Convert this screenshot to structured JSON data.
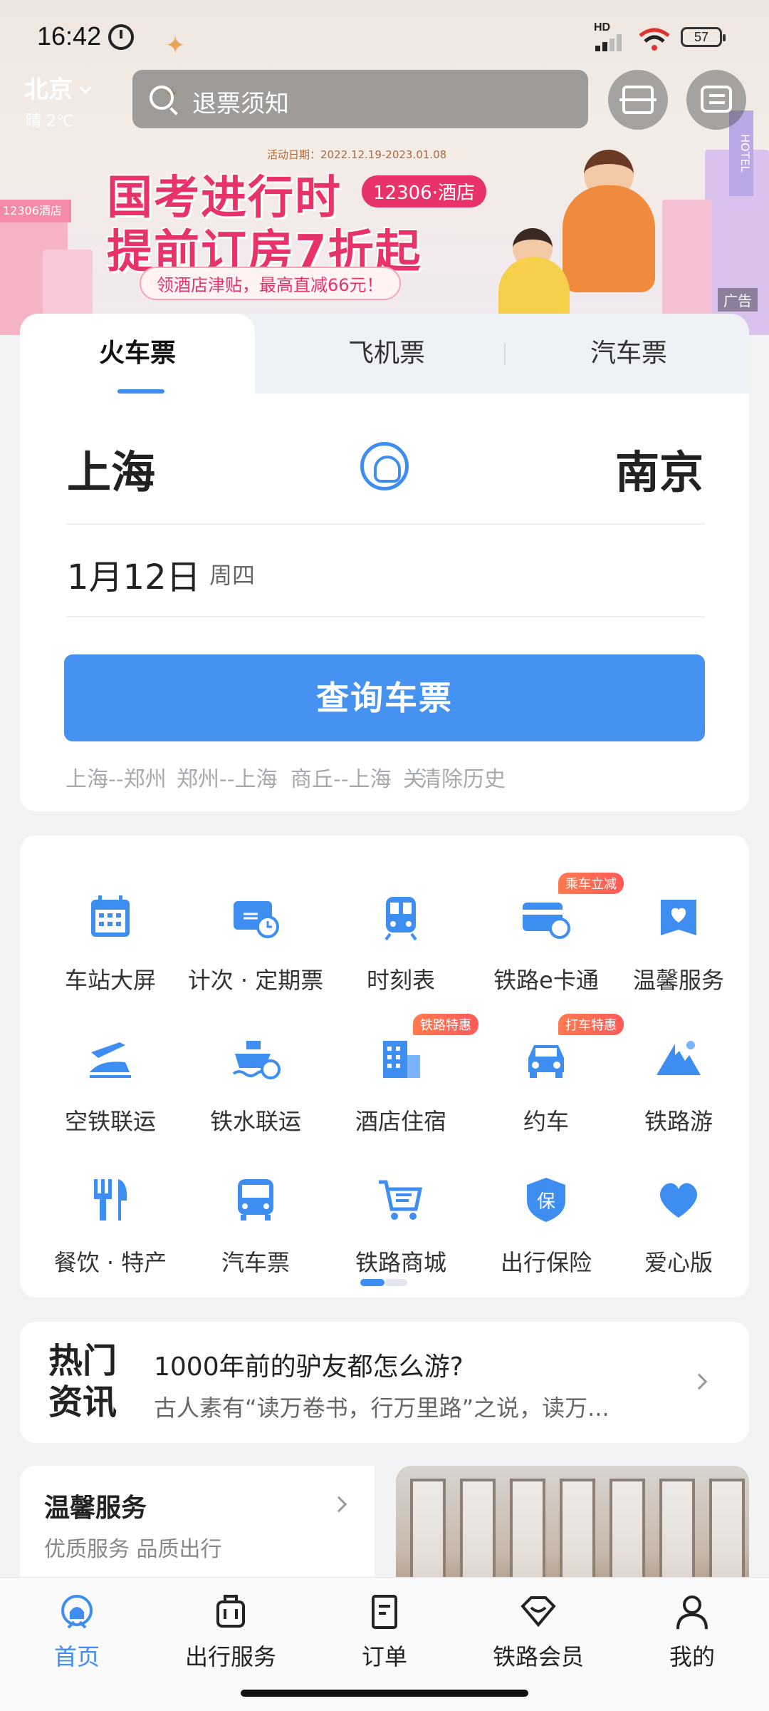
{
  "status_bar": {
    "time": "16:42",
    "network": "HD",
    "battery": "57"
  },
  "header": {
    "city": "北京",
    "weather": "晴 2℃",
    "search_placeholder": "退票须知"
  },
  "ad": {
    "date": "活动日期：2022.12.19-2023.01.08",
    "line1": "国考进行时",
    "badge": "12306·酒店",
    "line2": "提前订房7折起",
    "pill": "领酒店津贴，最高直减66元！",
    "hotel_sign": "12306酒店",
    "hotel_vertical": "HOTEL",
    "tag": "广告"
  },
  "ticket_tabs": [
    {
      "label": "火车票"
    },
    {
      "label": "飞机票"
    },
    {
      "label": "汽车票"
    }
  ],
  "booking": {
    "from": "上海",
    "to": "南京",
    "date": "1月12日",
    "weekday": "周四",
    "query_label": "查询车票",
    "history": [
      "上海--郑州",
      "郑州--上海",
      "商丘--上海",
      "关"
    ],
    "clear_label": "清除历史"
  },
  "services": [
    {
      "label": "车站大屏",
      "icon": "calendar-icon"
    },
    {
      "label": "计次 · 定期票",
      "icon": "ticket-clock-icon"
    },
    {
      "label": "时刻表",
      "icon": "train-icon"
    },
    {
      "label": "铁路e卡通",
      "icon": "card-icon",
      "badge": "乘车立减"
    },
    {
      "label": "温馨服务",
      "icon": "heart-bag-icon"
    },
    {
      "label": "空铁联运",
      "icon": "plane-train-icon"
    },
    {
      "label": "铁水联运",
      "icon": "ship-icon"
    },
    {
      "label": "酒店住宿",
      "icon": "hotel-icon",
      "badge": "铁路特惠"
    },
    {
      "label": "约车",
      "icon": "car-icon",
      "badge": "打车特惠"
    },
    {
      "label": "铁路游",
      "icon": "mountain-icon"
    },
    {
      "label": "餐饮 · 特产",
      "icon": "fork-knife-icon"
    },
    {
      "label": "汽车票",
      "icon": "bus-icon"
    },
    {
      "label": "铁路商城",
      "icon": "cart-icon"
    },
    {
      "label": "出行保险",
      "icon": "shield-icon"
    },
    {
      "label": "爱心版",
      "icon": "love-icon"
    }
  ],
  "news": {
    "logo_line1": "热门",
    "logo_line2": "资讯",
    "title": "1000年前的驴友都怎么游?",
    "summary": "古人素有“读万卷书，行万里路”之说，读万..."
  },
  "warm_service": {
    "title": "温馨服务",
    "subtitle": "优质服务 品质出行"
  },
  "bottom_nav": [
    {
      "label": "首页",
      "icon": "home-icon"
    },
    {
      "label": "出行服务",
      "icon": "luggage-icon"
    },
    {
      "label": "订单",
      "icon": "order-icon"
    },
    {
      "label": "铁路会员",
      "icon": "member-icon"
    },
    {
      "label": "我的",
      "icon": "profile-icon"
    }
  ],
  "colors": {
    "accent": "#3d8ef0",
    "button": "#4592f0",
    "ad_pink": "#e8336a",
    "badge": "#ff6a4d"
  }
}
